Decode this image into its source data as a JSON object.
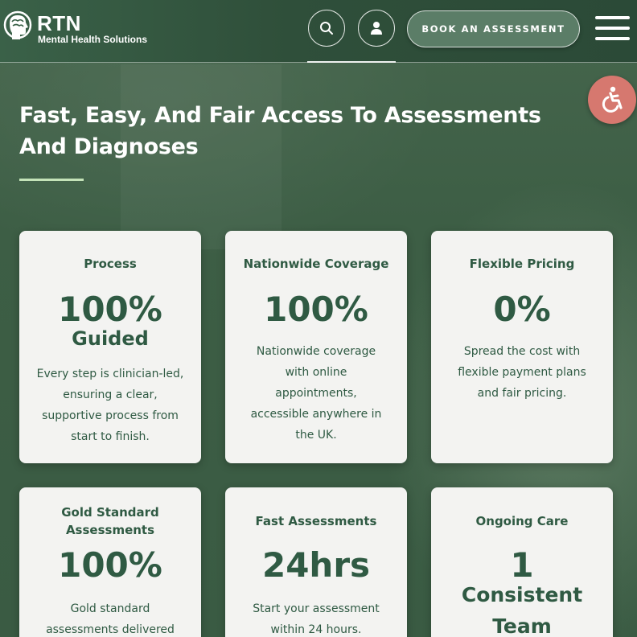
{
  "header": {
    "logo_word": "RTN",
    "logo_sub": "Mental Health Solutions",
    "search_icon": "search-icon",
    "account_icon": "user-icon",
    "book_label": "BOOK AN ASSESSMENT",
    "menu_icon": "hamburger-menu-icon"
  },
  "accessibility": {
    "icon": "wheelchair-accessibility-icon",
    "color": "#d6786f"
  },
  "hero": {
    "title": "Fast, Easy, And Fair Access To Assessments And Diagnoses"
  },
  "colors": {
    "accent": "#2f5a43",
    "card_bg": "#f3f3f1",
    "rule": "#c4e3b8"
  },
  "cards": [
    {
      "title": "Process",
      "stat": "100%",
      "stat_sub": "Guided",
      "desc": "Every step is clinician-led, ensuring a clear, supportive process from start to finish."
    },
    {
      "title": "Nationwide Coverage",
      "stat": "100%",
      "desc": "Nationwide coverage with online appointments, accessible anywhere in the UK."
    },
    {
      "title": "Flexible Pricing",
      "stat": "0%",
      "desc": "Spread the cost with flexible payment plans and fair pricing."
    },
    {
      "title": "Gold Standard Assessments",
      "stat": "100%",
      "desc": "Gold standard assessments delivered"
    },
    {
      "title": "Fast Assessments",
      "stat": "24hrs",
      "desc": "Start your assessment within 24 hours."
    },
    {
      "title": "Ongoing Care",
      "stat": "1",
      "stat_sub": "Consistent",
      "stat_sub2": "Team"
    }
  ]
}
